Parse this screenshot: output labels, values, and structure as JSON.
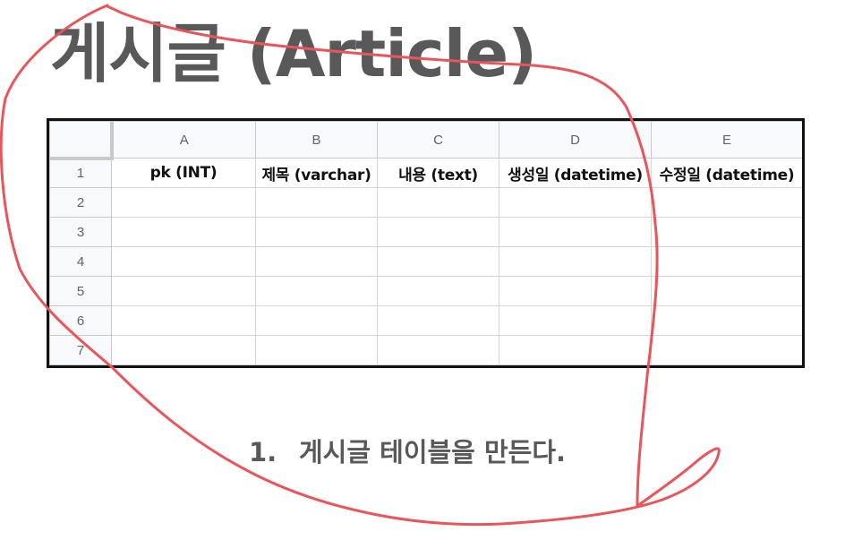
{
  "title": "게시글 (Article)",
  "sheet": {
    "columns": [
      "A",
      "B",
      "C",
      "D",
      "E"
    ],
    "rows": [
      "1",
      "2",
      "3",
      "4",
      "5",
      "6",
      "7"
    ],
    "header_cells": [
      "pk (INT)",
      "제목 (varchar)",
      "내용 (text)",
      "생성일 (datetime)",
      "수정일 (datetime)"
    ]
  },
  "caption": {
    "number": "1.",
    "text": "게시글 테이블을 만든다."
  },
  "annotation": {
    "stroke_color": "#e8565c"
  }
}
